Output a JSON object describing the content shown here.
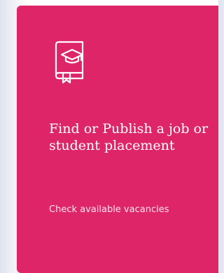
{
  "card": {
    "icon": "book-graduation-cap-icon",
    "title": "Find or Publish a job or student placement",
    "subtitle": "Check available vacancies",
    "background_color": "#dd2567",
    "text_color": "#ffffff"
  }
}
